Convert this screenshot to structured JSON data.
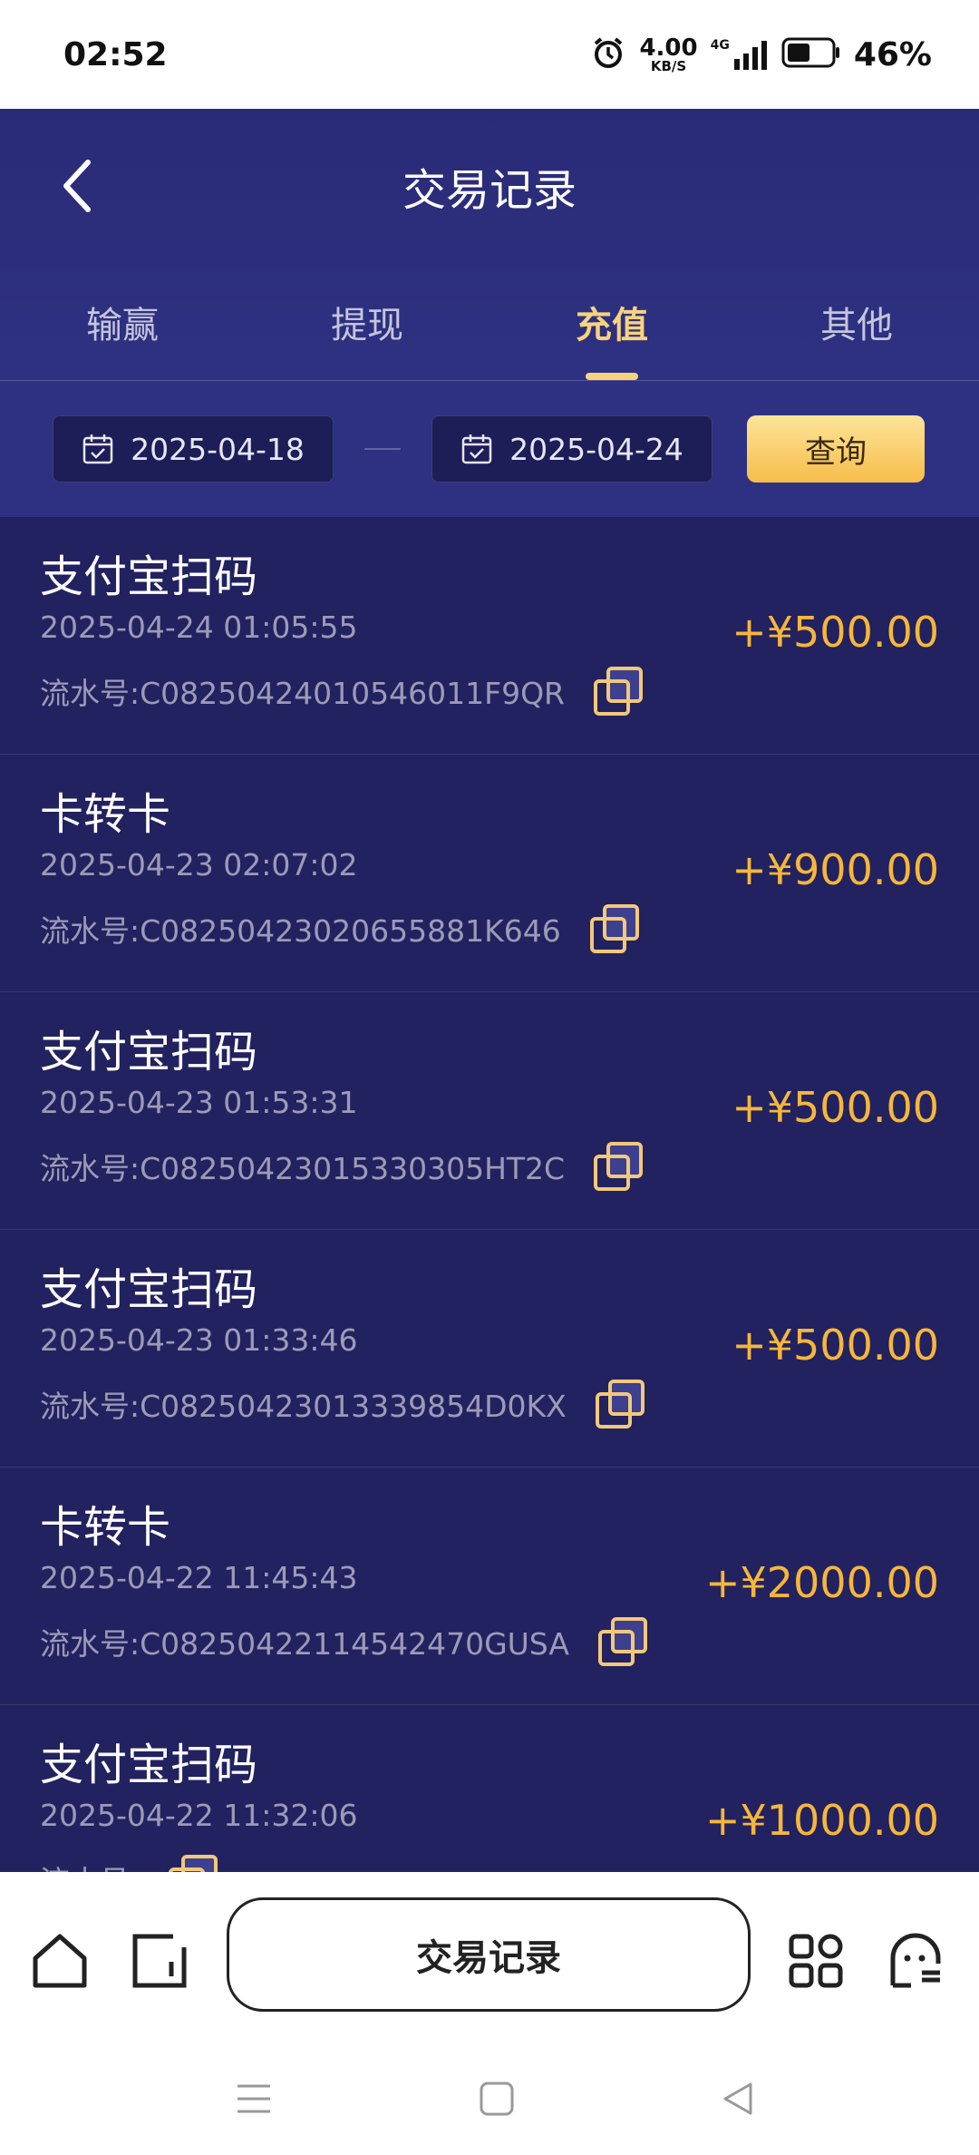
{
  "status_bar": {
    "time": "02:52",
    "net_speed_value": "4.00",
    "net_speed_unit": "KB/S",
    "battery_percent": "46%",
    "signal_label": "4G"
  },
  "header": {
    "title": "交易记录",
    "tabs": [
      {
        "label": "输赢",
        "active": false
      },
      {
        "label": "提现",
        "active": false
      },
      {
        "label": "充值",
        "active": true
      },
      {
        "label": "其他",
        "active": false
      }
    ]
  },
  "filter": {
    "start_date": "2025-04-18",
    "end_date": "2025-04-24",
    "query_label": "查询"
  },
  "records": [
    {
      "title": "支付宝扫码",
      "time": "2025-04-24 01:05:55",
      "serial": "流水号:C08250424010546011F9QR",
      "amount": "+¥500.00"
    },
    {
      "title": "卡转卡",
      "time": "2025-04-23 02:07:02",
      "serial": "流水号:C08250423020655881K646",
      "amount": "+¥900.00"
    },
    {
      "title": "支付宝扫码",
      "time": "2025-04-23 01:53:31",
      "serial": "流水号:C08250423015330305HT2C",
      "amount": "+¥500.00"
    },
    {
      "title": "支付宝扫码",
      "time": "2025-04-23 01:33:46",
      "serial": "流水号:C08250423013339854D0KX",
      "amount": "+¥500.00"
    },
    {
      "title": "卡转卡",
      "time": "2025-04-22 11:45:43",
      "serial": "流水号:C08250422114542470GUSA",
      "amount": "+¥2000.00"
    },
    {
      "title": "支付宝扫码",
      "time": "2025-04-22 11:32:06",
      "serial": "流水号:",
      "amount": "+¥1000.00"
    }
  ],
  "bottom_bar": {
    "center_label": "交易记录"
  },
  "colors": {
    "header_bg": "#2e3182",
    "list_bg": "#222260",
    "accent_gold": "#f7d37d",
    "amount_orange": "#f6b63a"
  }
}
